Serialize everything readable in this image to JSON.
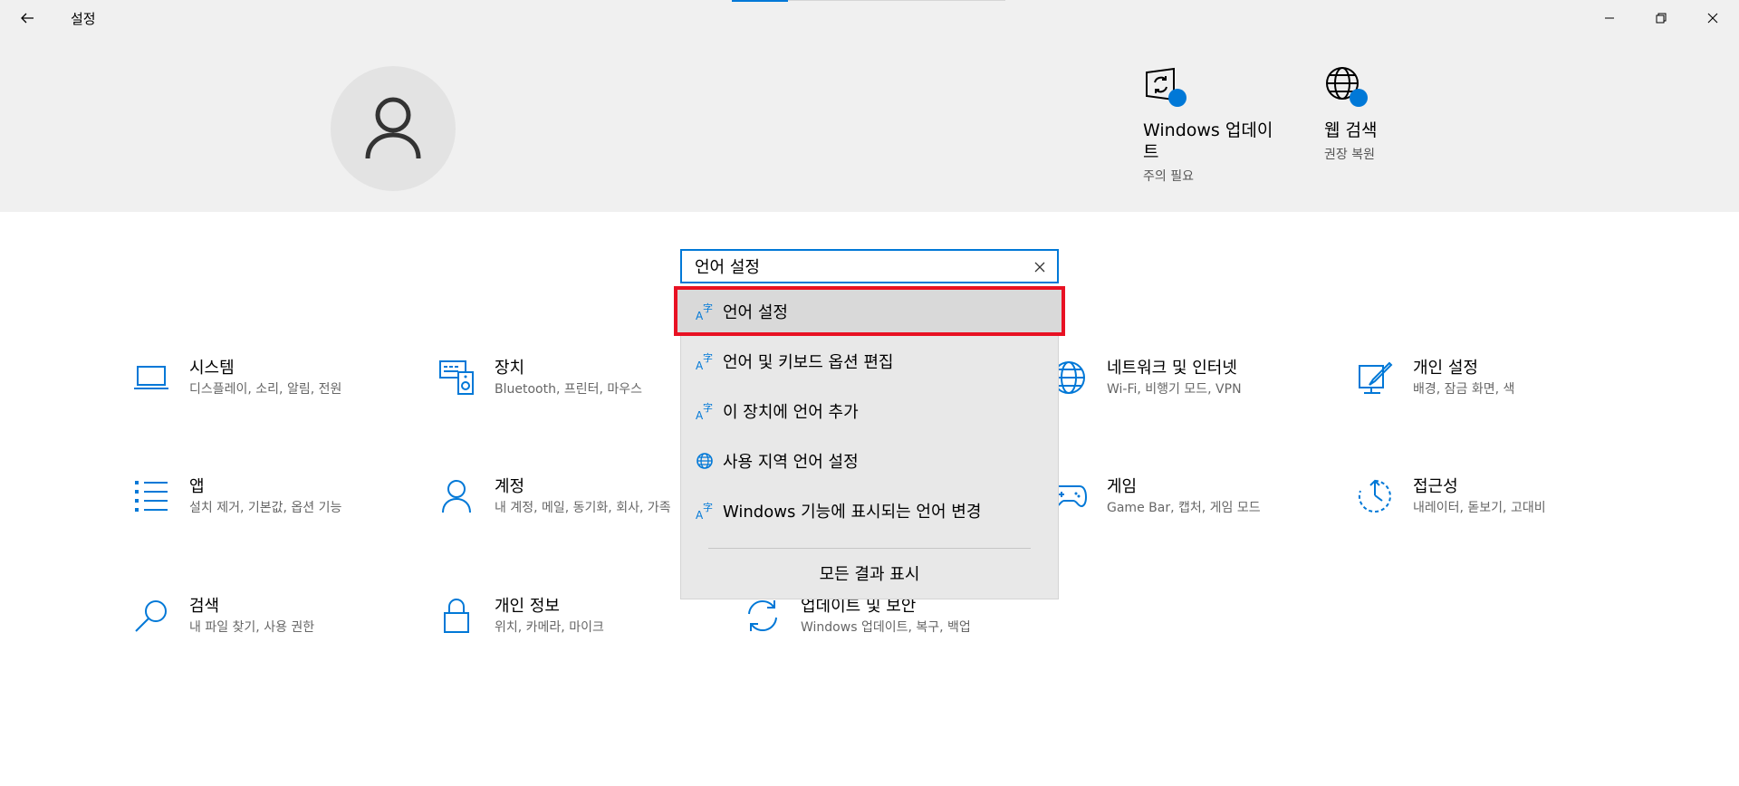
{
  "window": {
    "title": "설정",
    "back_icon": "back-arrow-icon",
    "minimize_icon": "minimize-icon",
    "maximize_icon": "restore-icon",
    "close_icon": "close-icon"
  },
  "header": {
    "avatar_icon": "user-icon",
    "tiles": [
      {
        "title": "Windows 업데이트",
        "subtitle": "주의 필요",
        "icon": "windows-update-icon"
      },
      {
        "title": "웹 검색",
        "subtitle": "권장 복원",
        "icon": "web-globe-icon"
      }
    ]
  },
  "search": {
    "value": "언어 설정",
    "clear_icon": "clear-icon",
    "results": [
      {
        "label": "언어 설정",
        "icon": "language-icon",
        "selected": true
      },
      {
        "label": "언어 및 키보드 옵션 편집",
        "icon": "language-icon",
        "selected": false
      },
      {
        "label": "이 장치에 언어 추가",
        "icon": "language-icon",
        "selected": false
      },
      {
        "label": "사용 지역 언어 설정",
        "icon": "region-globe-icon",
        "selected": false
      },
      {
        "label": "Windows 기능에 표시되는 언어 변경",
        "icon": "language-icon",
        "selected": false
      }
    ],
    "show_all": "모든 결과 표시"
  },
  "categories": [
    {
      "title": "시스템",
      "subtitle": "디스플레이, 소리, 알림, 전원",
      "icon": "laptop-icon"
    },
    {
      "title": "장치",
      "subtitle": "Bluetooth, 프린터, 마우스",
      "icon": "devices-icon"
    },
    {
      "title": "네트워크 및 인터넷",
      "subtitle": "Wi-Fi, 비행기 모드, VPN",
      "icon": "network-globe-icon"
    },
    {
      "title": "개인 설정",
      "subtitle": "배경, 잠금 화면, 색",
      "icon": "personalization-icon"
    },
    {
      "title": "앱",
      "subtitle": "설치 제거, 기본값, 옵션 기능",
      "icon": "apps-list-icon"
    },
    {
      "title": "계정",
      "subtitle": "내 계정, 메일, 동기화, 회사, 가족",
      "icon": "account-icon"
    },
    {
      "title": "게임",
      "subtitle": "Game Bar, 캡처, 게임 모드",
      "icon": "gamepad-icon"
    },
    {
      "title": "접근성",
      "subtitle": "내레이터, 돋보기, 고대비",
      "icon": "ease-of-access-icon"
    },
    {
      "title": "검색",
      "subtitle": "내 파일 찾기, 사용 권한",
      "icon": "search-icon"
    },
    {
      "title": "개인 정보",
      "subtitle": "위치, 카메라, 마이크",
      "icon": "lock-icon"
    },
    {
      "title": "업데이트 및 보안",
      "subtitle": "Windows 업데이트, 복구, 백업",
      "icon": "sync-icon"
    }
  ],
  "colors": {
    "accent": "#0078d7",
    "highlight_border": "#e81123",
    "header_bg": "#f0f0f0"
  }
}
